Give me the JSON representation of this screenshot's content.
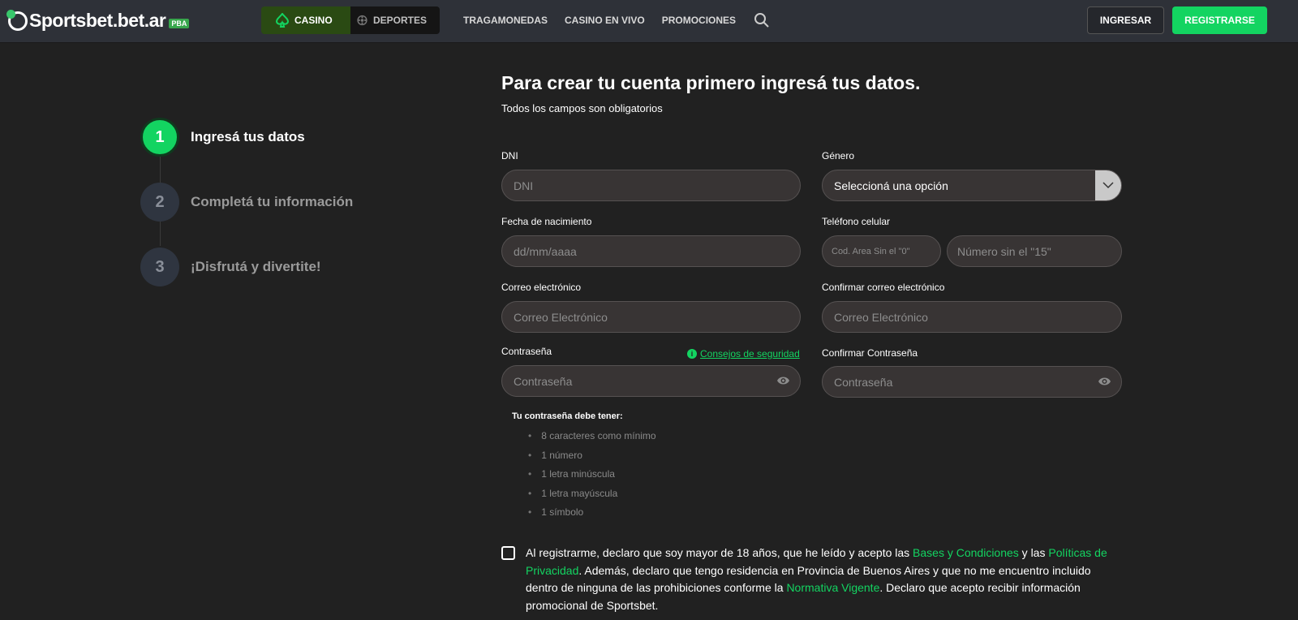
{
  "header": {
    "logo": "Sportsbet.bet.ar",
    "logo_badge": "PBA",
    "casino": "CASINO",
    "deportes": "DEPORTES",
    "nav": [
      "TRAGAMONEDAS",
      "CASINO EN VIVO",
      "PROMOCIONES"
    ],
    "login": "INGRESAR",
    "register": "REGISTRARSE"
  },
  "steps": [
    {
      "num": "1",
      "label": "Ingresá tus datos",
      "active": true
    },
    {
      "num": "2",
      "label": "Completá tu información"
    },
    {
      "num": "3",
      "label": "¡Disfrutá y divertite!"
    }
  ],
  "form": {
    "title": "Para crear tu cuenta primero ingresá tus datos.",
    "subtitle": "Todos los campos son obligatorios",
    "dni_label": "DNI",
    "dni_ph": "DNI",
    "genero_label": "Género",
    "genero_value": "Seleccioná una opción",
    "fecha_label": "Fecha de nacimiento",
    "fecha_ph": "dd/mm/aaaa",
    "tel_label": "Teléfono celular",
    "area_ph": "Cod. Area Sin el \"0\"",
    "num_ph": "Número sin el  \"15\"",
    "email_label": "Correo electrónico",
    "email_ph": "Correo Electrónico",
    "email2_label": "Confirmar correo electrónico",
    "email2_ph": "Correo Electrónico",
    "pass_label": "Contraseña",
    "pass_ph": "Contraseña",
    "tips": "Consejos de seguridad",
    "pass2_label": "Confirmar Contraseña",
    "pass2_ph": "Contraseña",
    "req_title": "Tu contraseña debe tener:",
    "reqs": [
      "8 caracteres como mínimo",
      "1 número",
      "1 letra minúscula",
      "1 letra mayúscula",
      "1 símbolo"
    ],
    "legal": {
      "t1": "Al registrarme, declaro que soy mayor de 18 años, que he leído y acepto las ",
      "l1": "Bases y Condiciones",
      "t2": " y las ",
      "l2": "Políticas de Privacidad",
      "t3": ". Además, declaro que tengo residencia en Provincia de Buenos Aires y que no me encuentro incluido dentro de ninguna de las prohibiciones conforme la ",
      "l3": "Normativa Vigente",
      "t4": ". Declaro que acepto recibir información promocional de Sportsbet."
    }
  },
  "colors": {
    "accent": "#13d461",
    "background": "#212121",
    "header": "#2e3138"
  }
}
